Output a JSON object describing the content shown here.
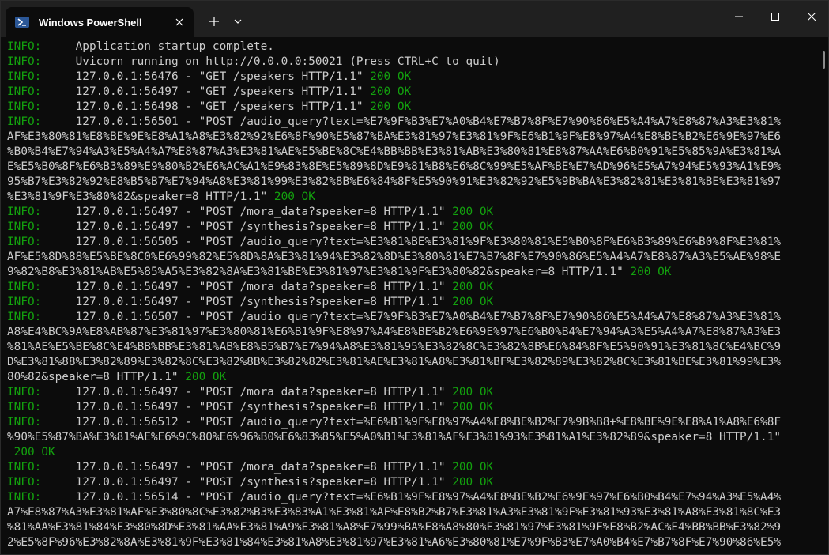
{
  "window": {
    "tab_title": "Windows PowerShell",
    "tab_icon": "powershell-icon"
  },
  "colors": {
    "info": "#13a10e",
    "text": "#cccccc",
    "background": "#0c0c0c",
    "titlebar": "#202020"
  },
  "terminal": {
    "lines": [
      {
        "kind": "info",
        "prefix": "INFO:",
        "body": "     Application startup complete."
      },
      {
        "kind": "info",
        "prefix": "INFO:",
        "body": "     Uvicorn running on http://0.0.0.0:50021 (Press CTRL+C to quit)"
      },
      {
        "kind": "info",
        "prefix": "INFO:",
        "body": "     127.0.0.1:56476 - \"GET /speakers HTTP/1.1\" ",
        "ok": "200 OK"
      },
      {
        "kind": "info",
        "prefix": "INFO:",
        "body": "     127.0.0.1:56497 - \"GET /speakers HTTP/1.1\" ",
        "ok": "200 OK"
      },
      {
        "kind": "info",
        "prefix": "INFO:",
        "body": "     127.0.0.1:56498 - \"GET /speakers HTTP/1.1\" ",
        "ok": "200 OK"
      },
      {
        "kind": "info",
        "prefix": "INFO:",
        "body": "     127.0.0.1:56501 - \"POST /audio_query?text=%E7%9F%B3%E7%A0%B4%E7%B7%8F%E7%90%86%E5%A4%A7%E8%87%A3%E3%81%"
      },
      {
        "kind": "cont",
        "body": "AF%E3%80%81%E8%BE%9E%E8%A1%A8%E3%82%92%E6%8F%90%E5%87%BA%E3%81%97%E3%81%9F%E6%B1%9F%E8%97%A4%E8%BE%B2%E6%9E%97%E6"
      },
      {
        "kind": "cont",
        "body": "%B0%B4%E7%94%A3%E5%A4%A7%E8%87%A3%E3%81%AE%E5%BE%8C%E4%BB%BB%E3%81%AB%E3%80%81%E8%87%AA%E6%B0%91%E5%85%9A%E3%81%A"
      },
      {
        "kind": "cont",
        "body": "E%E5%B0%8F%E6%B3%89%E9%80%B2%E6%AC%A1%E9%83%8E%E5%89%8D%E9%81%B8%E6%8C%99%E5%AF%BE%E7%AD%96%E5%A7%94%E5%93%A1%E9%"
      },
      {
        "kind": "cont",
        "body": "95%B7%E3%82%92%E8%B5%B7%E7%94%A8%E3%81%99%E3%82%8B%E6%84%8F%E5%90%91%E3%82%92%E5%9B%BA%E3%82%81%E3%81%BE%E3%81%97"
      },
      {
        "kind": "cont",
        "body": "%E3%81%9F%E3%80%82&speaker=8 HTTP/1.1\" ",
        "ok": "200 OK"
      },
      {
        "kind": "info",
        "prefix": "INFO:",
        "body": "     127.0.0.1:56497 - \"POST /mora_data?speaker=8 HTTP/1.1\" ",
        "ok": "200 OK"
      },
      {
        "kind": "info",
        "prefix": "INFO:",
        "body": "     127.0.0.1:56497 - \"POST /synthesis?speaker=8 HTTP/1.1\" ",
        "ok": "200 OK"
      },
      {
        "kind": "info",
        "prefix": "INFO:",
        "body": "     127.0.0.1:56505 - \"POST /audio_query?text=%E3%81%BE%E3%81%9F%E3%80%81%E5%B0%8F%E6%B3%89%E6%B0%8F%E3%81%"
      },
      {
        "kind": "cont",
        "body": "AF%E5%8D%88%E5%BE%8C0%E6%99%82%E5%8D%8A%E3%81%94%E3%82%8D%E3%80%81%E7%B7%8F%E7%90%86%E5%A4%A7%E8%87%A3%E5%AE%98%E"
      },
      {
        "kind": "cont",
        "body": "9%82%B8%E3%81%AB%E5%85%A5%E3%82%8A%E3%81%BE%E3%81%97%E3%81%9F%E3%80%82&speaker=8 HTTP/1.1\" ",
        "ok": "200 OK"
      },
      {
        "kind": "info",
        "prefix": "INFO:",
        "body": "     127.0.0.1:56497 - \"POST /mora_data?speaker=8 HTTP/1.1\" ",
        "ok": "200 OK"
      },
      {
        "kind": "info",
        "prefix": "INFO:",
        "body": "     127.0.0.1:56497 - \"POST /synthesis?speaker=8 HTTP/1.1\" ",
        "ok": "200 OK"
      },
      {
        "kind": "info",
        "prefix": "INFO:",
        "body": "     127.0.0.1:56507 - \"POST /audio_query?text=%E7%9F%B3%E7%A0%B4%E7%B7%8F%E7%90%86%E5%A4%A7%E8%87%A3%E3%81%"
      },
      {
        "kind": "cont",
        "body": "A8%E4%BC%9A%E8%AB%87%E3%81%97%E3%80%81%E6%B1%9F%E8%97%A4%E8%BE%B2%E6%9E%97%E6%B0%B4%E7%94%A3%E5%A4%A7%E8%87%A3%E3"
      },
      {
        "kind": "cont",
        "body": "%81%AE%E5%BE%8C%E4%BB%BB%E3%81%AB%E8%B5%B7%E7%94%A8%E3%81%95%E3%82%8C%E3%82%8B%E6%84%8F%E5%90%91%E3%81%8C%E4%BC%9"
      },
      {
        "kind": "cont",
        "body": "D%E3%81%88%E3%82%89%E3%82%8C%E3%82%8B%E3%82%82%E3%81%AE%E3%81%A8%E3%81%BF%E3%82%89%E3%82%8C%E3%81%BE%E3%81%99%E3%"
      },
      {
        "kind": "cont",
        "body": "80%82&speaker=8 HTTP/1.1\" ",
        "ok": "200 OK"
      },
      {
        "kind": "info",
        "prefix": "INFO:",
        "body": "     127.0.0.1:56497 - \"POST /mora_data?speaker=8 HTTP/1.1\" ",
        "ok": "200 OK"
      },
      {
        "kind": "info",
        "prefix": "INFO:",
        "body": "     127.0.0.1:56497 - \"POST /synthesis?speaker=8 HTTP/1.1\" ",
        "ok": "200 OK"
      },
      {
        "kind": "info",
        "prefix": "INFO:",
        "body": "     127.0.0.1:56512 - \"POST /audio_query?text=%E6%B1%9F%E8%97%A4%E8%BE%B2%E7%9B%B8+%E8%BE%9E%E8%A1%A8%E6%8F"
      },
      {
        "kind": "cont",
        "body": "%90%E5%87%BA%E3%81%AE%E6%9C%80%E6%96%B0%E6%83%85%E5%A0%B1%E3%81%AF%E3%81%93%E3%81%A1%E3%82%89&speaker=8 HTTP/1.1\""
      },
      {
        "kind": "cont",
        "body": " ",
        "ok": "200 OK"
      },
      {
        "kind": "info",
        "prefix": "INFO:",
        "body": "     127.0.0.1:56497 - \"POST /mora_data?speaker=8 HTTP/1.1\" ",
        "ok": "200 OK"
      },
      {
        "kind": "info",
        "prefix": "INFO:",
        "body": "     127.0.0.1:56497 - \"POST /synthesis?speaker=8 HTTP/1.1\" ",
        "ok": "200 OK"
      },
      {
        "kind": "info",
        "prefix": "INFO:",
        "body": "     127.0.0.1:56514 - \"POST /audio_query?text=%E6%B1%9F%E8%97%A4%E8%BE%B2%E6%9E%97%E6%B0%B4%E7%94%A3%E5%A4%"
      },
      {
        "kind": "cont",
        "body": "A7%E8%87%A3%E3%81%AF%E3%80%8C%E3%82%B3%E3%83%A1%E3%81%AF%E8%B2%B7%E3%81%A3%E3%81%9F%E3%81%93%E3%81%A8%E3%81%8C%E3"
      },
      {
        "kind": "cont",
        "body": "%81%AA%E3%81%84%E3%80%8D%E3%81%AA%E3%81%A9%E3%81%A8%E7%99%BA%E8%A8%80%E3%81%97%E3%81%9F%E8%B2%AC%E4%BB%BB%E3%82%9"
      },
      {
        "kind": "cont",
        "body": "2%E5%8F%96%E3%82%8A%E3%81%9F%E3%81%84%E3%81%A8%E3%81%97%E3%81%A6%E3%80%81%E7%9F%B3%E7%A0%B4%E7%B7%8F%E7%90%86%E5%"
      }
    ]
  }
}
